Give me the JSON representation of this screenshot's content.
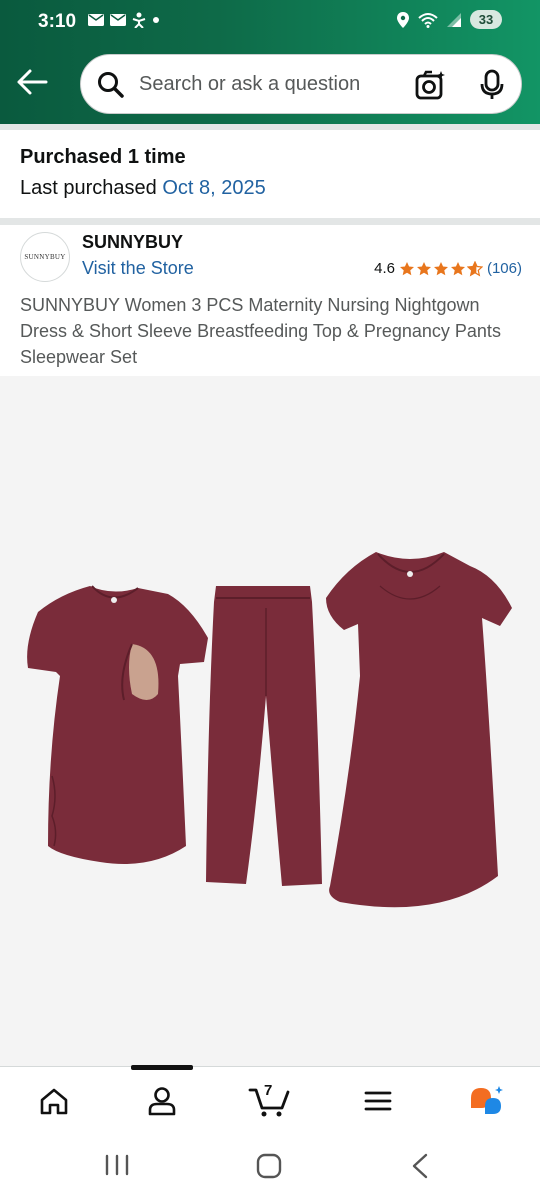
{
  "status_bar": {
    "time": "3:10",
    "battery": "33"
  },
  "search": {
    "placeholder": "Search or ask a question"
  },
  "purchase_info": {
    "title": "Purchased 1 time",
    "last_label": "Last purchased ",
    "last_date": "Oct 8, 2025"
  },
  "brand": {
    "logo_text": "SUNNYBUY",
    "name": "SUNNYBUY",
    "visit_store": "Visit the Store"
  },
  "rating": {
    "value": "4.6",
    "stars": 4.6,
    "count": "(106)"
  },
  "product": {
    "title": "SUNNYBUY Women 3 PCS Maternity Nursing Nightgown Dress & Short Sleeve Breastfeeding Top & Pregnancy Pants Sleepwear Set",
    "garment_color": "#7a2c3a"
  },
  "bottom_nav": {
    "items": [
      "home-icon",
      "account-icon",
      "cart-icon",
      "menu-icon",
      "rufus-icon"
    ],
    "cart_count": "7",
    "active": "account-icon"
  },
  "colors": {
    "header_start": "#0a5a3e",
    "header_end": "#129565",
    "link": "#2162a1",
    "star": "#e8761d"
  }
}
